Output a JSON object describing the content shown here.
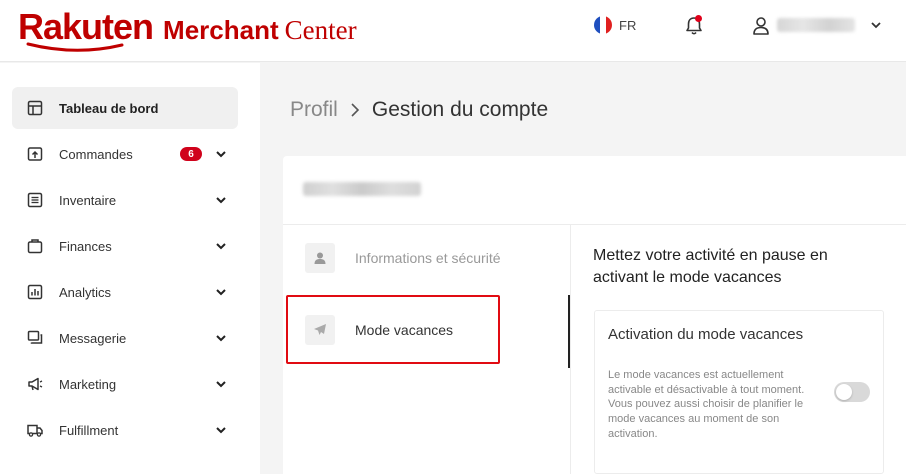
{
  "header": {
    "logo": {
      "brand": "Rakuten",
      "merchant": "Merchant",
      "center": "Center"
    },
    "language": "FR",
    "colors": {
      "brand": "#bf0000",
      "notification_dot": "#e0001a"
    }
  },
  "sidebar": {
    "items": [
      {
        "label": "Tableau de bord",
        "icon": "dashboard-icon",
        "active": true
      },
      {
        "label": "Commandes",
        "icon": "orders-icon",
        "badge": "6",
        "expandable": true
      },
      {
        "label": "Inventaire",
        "icon": "inventory-icon",
        "expandable": true
      },
      {
        "label": "Finances",
        "icon": "finances-icon",
        "expandable": true
      },
      {
        "label": "Analytics",
        "icon": "analytics-icon",
        "expandable": true
      },
      {
        "label": "Messagerie",
        "icon": "messaging-icon",
        "expandable": true
      },
      {
        "label": "Marketing",
        "icon": "megaphone-icon",
        "expandable": true
      },
      {
        "label": "Fulfillment",
        "icon": "truck-icon",
        "expandable": true
      }
    ]
  },
  "breadcrumb": {
    "parent": "Profil",
    "current": "Gestion du compte"
  },
  "account_menu": [
    {
      "label": "Informations et sécurité",
      "icon": "user-icon",
      "active": false
    },
    {
      "label": "Mode vacances",
      "icon": "airplane-icon",
      "active": true
    }
  ],
  "vacation": {
    "heading": "Mettez votre activité en pause en activant le mode vacances",
    "card_title": "Activation du mode vacances",
    "card_description": "Le mode vacances est actuellement activable et désactivable à tout moment. Vous pouvez aussi choisir de planifier le mode vacances au moment de son activation.",
    "toggle_on": false
  }
}
